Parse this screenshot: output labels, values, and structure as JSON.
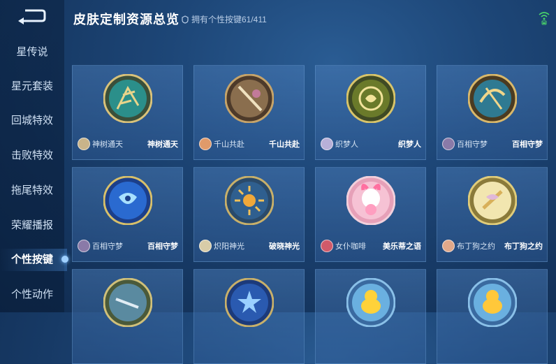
{
  "header": {
    "title": "皮肤定制资源总览",
    "count_text": "拥有个性按键61/411"
  },
  "sidebar": {
    "items": [
      {
        "label": "星传说"
      },
      {
        "label": "星元套装"
      },
      {
        "label": "回城特效"
      },
      {
        "label": "击败特效"
      },
      {
        "label": "拖尾特效"
      },
      {
        "label": "荣耀播报"
      },
      {
        "label": "个性按键"
      },
      {
        "label": "个性动作"
      }
    ],
    "active_index": 6
  },
  "cards": [
    {
      "hero": "神树通天",
      "skin": "神树通天",
      "icon": "antler-emblem-icon"
    },
    {
      "hero": "千山共赴",
      "skin": "千山共赴",
      "icon": "sword-emblem-icon"
    },
    {
      "hero": "织梦人",
      "skin": "织梦人",
      "icon": "dragon-emblem-icon"
    },
    {
      "hero": "百相守梦",
      "skin": "百相守梦",
      "icon": "crossbow-emblem-icon"
    },
    {
      "hero": "百相守梦",
      "skin": "百相守梦",
      "icon": "koi-emblem-icon"
    },
    {
      "hero": "炽阳神光",
      "skin": "破晓神光",
      "icon": "sun-emblem-icon"
    },
    {
      "hero": "女仆咖啡",
      "skin": "美乐蒂之语",
      "icon": "melody-emblem-icon"
    },
    {
      "hero": "布丁狗之约",
      "skin": "布丁狗之约",
      "icon": "ribbon-emblem-icon"
    },
    {
      "hero": "",
      "skin": "",
      "icon": "blade-emblem-icon"
    },
    {
      "hero": "",
      "skin": "",
      "icon": "star-emblem-icon"
    },
    {
      "hero": "",
      "skin": "",
      "icon": "duck-emblem-icon"
    },
    {
      "hero": "",
      "skin": "",
      "icon": "duck-emblem-icon"
    }
  ],
  "colors": {
    "background": "#1d4677",
    "card": "#4b7db9",
    "accent": "#9fd0ff"
  }
}
